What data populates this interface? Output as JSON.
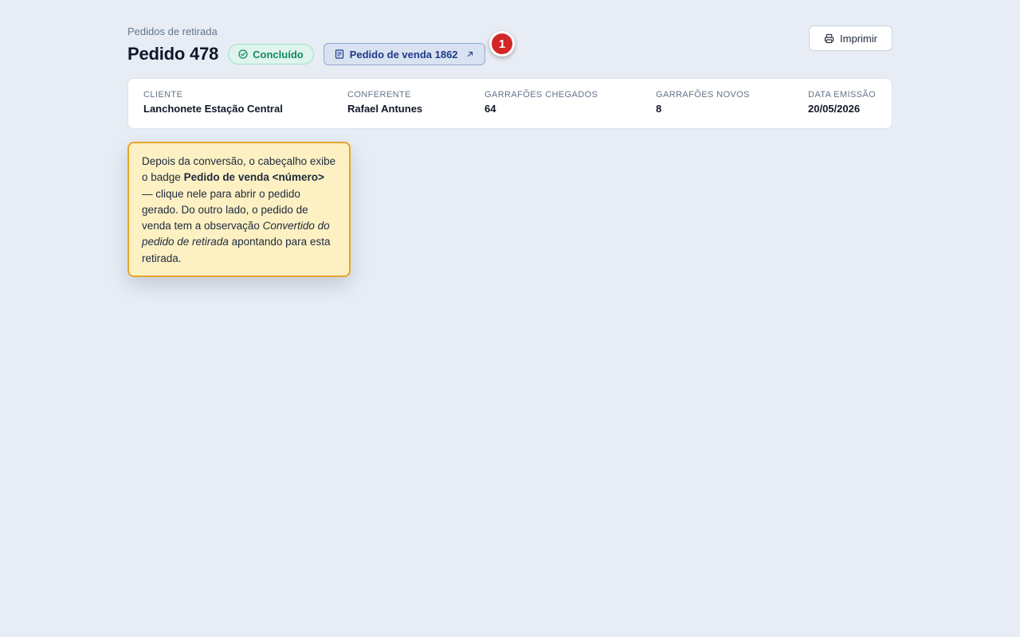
{
  "header": {
    "breadcrumb": "Pedidos de retirada",
    "title": "Pedido 478",
    "status_badge": "Concluído",
    "sales_order_badge": "Pedido de venda 1862",
    "marker": "1",
    "print_label": "Imprimir"
  },
  "info": [
    {
      "label": "Cliente",
      "value": "Lanchonete Estação Central"
    },
    {
      "label": "Conferente",
      "value": "Rafael Antunes"
    },
    {
      "label": "Garrafões chegados",
      "value": "64"
    },
    {
      "label": "Garrafões novos",
      "value": "8"
    },
    {
      "label": "Data emissão",
      "value": "20/05/2026"
    }
  ],
  "tooltip": {
    "t1": "Depois da conversão, o cabeçalho exibe o badge ",
    "t2": "Pedido de venda <número>",
    "t3": " — clique nele para abrir o pedido gerado. Do outro lado, o pedido de venda tem a observação ",
    "t4": "Convertido do pedido de retirada",
    "t5": " apontando para esta retirada."
  },
  "colors": {
    "status_green": "#0f8a5f",
    "sales_blue": "#1e3a8a",
    "marker_red": "#d32626",
    "tooltip_bg": "#fdf1c4",
    "tooltip_border": "#e6a52b"
  }
}
